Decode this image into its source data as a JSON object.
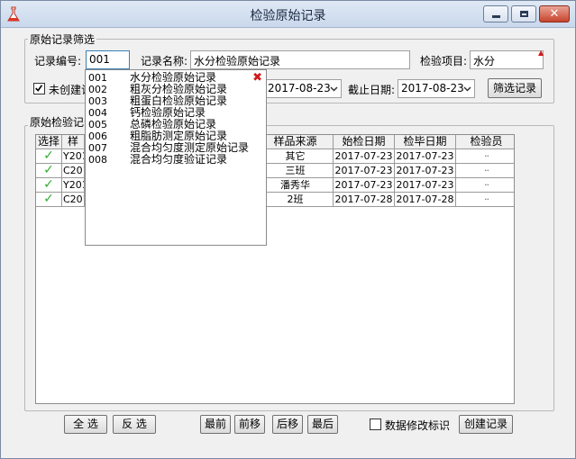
{
  "window": {
    "title": "检验原始记录"
  },
  "filter": {
    "group_title": "原始记录筛选",
    "record_no_label": "记录编号:",
    "record_no_value": "001",
    "record_name_label": "记录名称:",
    "record_name_value": "水分检验原始记录",
    "item_label": "检验项目:",
    "item_value": "水分",
    "not_created_label": "未创建记",
    "start_date_value": "2017-08-23",
    "end_date_label": "截止日期:",
    "end_date_value": "2017-08-23",
    "filter_button": "筛选记录"
  },
  "records": {
    "group_title": "原始检验记录",
    "columns": [
      "选择",
      "样",
      "样品来源",
      "始检日期",
      "检毕日期",
      "检验员"
    ],
    "rows": [
      {
        "code": "Y201",
        "source": "其它",
        "start": "2017-07-23",
        "end": "2017-07-23"
      },
      {
        "code": "C201",
        "source": "三班",
        "start": "2017-07-23",
        "end": "2017-07-23"
      },
      {
        "code": "Y201",
        "source": "潘秀华",
        "start": "2017-07-23",
        "end": "2017-07-23"
      },
      {
        "code": "C201",
        "source": "2班",
        "start": "2017-07-28",
        "end": "2017-07-28"
      }
    ]
  },
  "dropdown": {
    "items": [
      {
        "code": "001",
        "name": "水分检验原始记录"
      },
      {
        "code": "002",
        "name": "粗灰分检验原始记录"
      },
      {
        "code": "003",
        "name": "粗蛋白检验原始记录"
      },
      {
        "code": "004",
        "name": "钙检验原始记录"
      },
      {
        "code": "005",
        "name": "总磷检验原始记录"
      },
      {
        "code": "006",
        "name": "粗脂肪测定原始记录"
      },
      {
        "code": "007",
        "name": "混合均匀度测定原始记录"
      },
      {
        "code": "008",
        "name": "混合均匀度验证记录"
      }
    ]
  },
  "bottom": {
    "select_all": "全 选",
    "invert": "反 选",
    "first": "最前",
    "prev": "前移",
    "next": "后移",
    "last": "最后",
    "modified_flag_label": "数据修改标识",
    "create_button": "创建记录"
  }
}
